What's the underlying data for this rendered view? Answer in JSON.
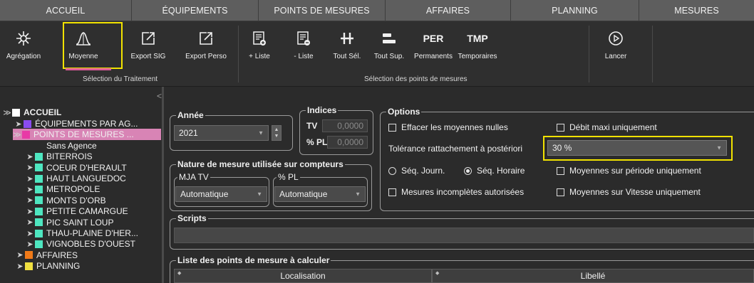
{
  "nav": [
    "ACCUEIL",
    "ÉQUIPEMENTS",
    "POINTS DE MESURES",
    "AFFAIRES",
    "PLANNING",
    "MESURES"
  ],
  "toolbar": {
    "buttons": [
      {
        "label": "Agrégation",
        "icon": "aggregation-icon"
      },
      {
        "label": "Moyenne",
        "icon": "bell-curve-icon"
      },
      {
        "label": "Export SIG",
        "icon": "export-icon"
      },
      {
        "label": "Export Perso",
        "icon": "export-icon"
      },
      {
        "label": "+ Liste",
        "icon": "list-add-icon"
      },
      {
        "label": "- Liste",
        "icon": "list-remove-icon"
      },
      {
        "label": "Tout Sél.",
        "icon": "select-all-icon"
      },
      {
        "label": "Tout Sup.",
        "icon": "delete-all-icon"
      },
      {
        "label": "Permanents",
        "icon_text": "PER"
      },
      {
        "label": "Temporaires",
        "icon_text": "TMP"
      },
      {
        "label": "Lancer",
        "icon": "play-icon"
      }
    ],
    "group_treatment": "Sélection du Traitement",
    "group_points": "Sélection des points de mesures"
  },
  "tree": {
    "root": "ACCUEIL",
    "items": [
      {
        "label": "ÉQUIPEMENTS PAR AG...",
        "color": "#8a4bf0"
      },
      {
        "label": "POINTS DE MESURES ...",
        "color": "#e83aa6"
      },
      {
        "label": "Sans Agence",
        "color": "#4ee6c0"
      },
      {
        "label": "BITERROIS",
        "color": "#4ee6c0"
      },
      {
        "label": "COEUR D'HERAULT",
        "color": "#4ee6c0"
      },
      {
        "label": "HAUT LANGUEDOC",
        "color": "#4ee6c0"
      },
      {
        "label": "METROPOLE",
        "color": "#4ee6c0"
      },
      {
        "label": "MONTS D'ORB",
        "color": "#4ee6c0"
      },
      {
        "label": "PETITE CAMARGUE",
        "color": "#4ee6c0"
      },
      {
        "label": "PIC SAINT LOUP",
        "color": "#4ee6c0"
      },
      {
        "label": "THAU-PLAINE D'HER...",
        "color": "#4ee6c0"
      },
      {
        "label": "VIGNOBLES D'OUEST",
        "color": "#4ee6c0"
      },
      {
        "label": "AFFAIRES",
        "color": "#f07a18"
      },
      {
        "label": "PLANNING",
        "color": "#f0e040"
      }
    ]
  },
  "annee": {
    "title": "Année",
    "value": "2021"
  },
  "indices": {
    "title": "Indices",
    "tv_label": "TV",
    "tv_value": "0,0000",
    "pl_label": "% PL",
    "pl_value": "0,0000"
  },
  "nature": {
    "title": "Nature de mesure utilisée sur compteurs",
    "mja_title": "MJA TV",
    "mja_value": "Automatique",
    "pl_title": "% PL",
    "pl_value": "Automatique"
  },
  "options": {
    "title": "Options",
    "effacer": "Effacer les moyennes nulles",
    "debit": "Débit maxi uniquement",
    "tolerance_label": "Tolérance rattachement à postériori",
    "tolerance_value": "30 %",
    "seq_journ": "Séq. Journ.",
    "seq_horaire": "Séq. Horaire",
    "moy_periode": "Moyennes sur période uniquement",
    "incompletes": "Mesures incomplètes autorisées",
    "moy_vitesse": "Moyennes sur Vitesse uniquement"
  },
  "scripts": {
    "title": "Scripts"
  },
  "liste": {
    "title": "Liste des points de mesure à calculer",
    "columns": [
      "Localisation",
      "Libellé"
    ]
  },
  "colors": {
    "highlight": "#f2e200",
    "selected_row": "#d884b5",
    "underline": "#e05b9a"
  }
}
